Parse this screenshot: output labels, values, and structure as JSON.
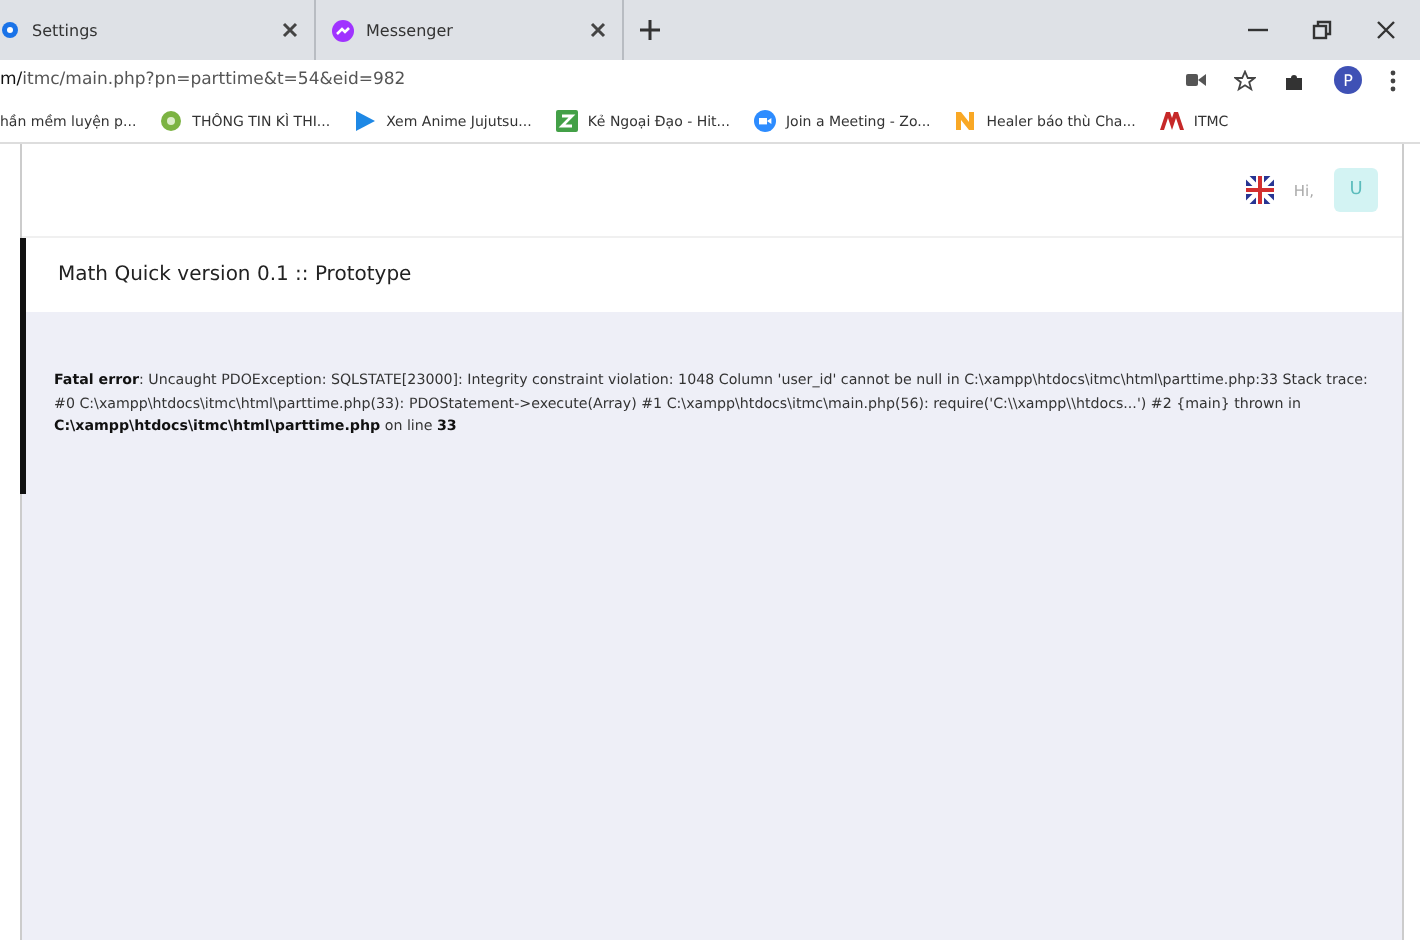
{
  "browser": {
    "tabs": [
      {
        "title": "Settings",
        "selected": false
      },
      {
        "title": "Messenger",
        "selected": false
      }
    ],
    "address": "m/itmc/main.php?pn=parttime&t=54&eid=982",
    "profile_initial": "P",
    "bookmarks": [
      "hần mềm luyện p...",
      "THÔNG TIN KÌ THI...",
      "Xem Anime Jujutsu...",
      "Kẻ Ngoại Đạo - Hit...",
      "Join a Meeting - Zo...",
      "Healer báo thù Cha...",
      "ITMC"
    ]
  },
  "header": {
    "greeting": "Hi,",
    "avatar": "U"
  },
  "page_title": "Math Quick version 0.1 :: Prototype",
  "error": "**Fatal error**: Uncaught PDOException: SQLSTATE[23000]: Integrity constraint violation: 1048 Column 'user_id' cannot be null in C:\\xampp\\htdocs\\itmc\\html\\parttime.php:33 Stack trace: #0 C:\\xampp\\htdocs\\itmc\\html\\parttime.php(33): PDOStatement->execute(Array) #1 C:\\xampp\\htdocs\\itmc\\main.php(56): require('C:\\\\xampp\\\\htdocs...') #2 {main} thrown in **C:\\xampp\\htdocs\\itmc\\html\\parttime.php** on line **33**"
}
